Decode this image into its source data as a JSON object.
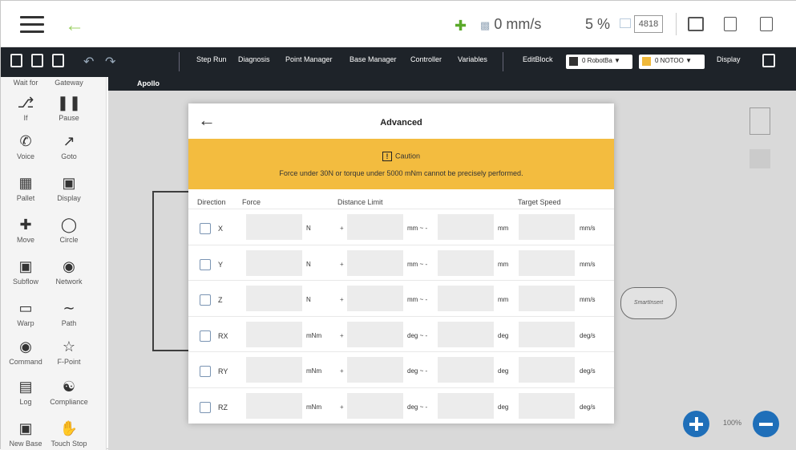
{
  "topbar": {
    "speed": "0 mm/s",
    "percent": "5 %",
    "code": "4818"
  },
  "toolbar": {
    "step_run": "Step Run",
    "diagnosis": "Diagnosis",
    "point_manager": "Point Manager",
    "base_manager": "Base Manager",
    "controller": "Controller",
    "variables": "Variables",
    "editblock": "EditBlock",
    "robot_select": "0 RobotBa",
    "tool_select": "0 NOTOO",
    "display": "Display"
  },
  "palette": [
    {
      "label": "Wait for",
      "icon": "wait-icon"
    },
    {
      "label": "Gateway",
      "icon": "gateway-icon"
    },
    {
      "label": "If",
      "icon": "if-icon"
    },
    {
      "label": "Pause",
      "icon": "pause-icon"
    },
    {
      "label": "Voice",
      "icon": "voice-icon"
    },
    {
      "label": "Goto",
      "icon": "goto-icon"
    },
    {
      "label": "Pallet",
      "icon": "pallet-icon"
    },
    {
      "label": "Display",
      "icon": "display-icon"
    },
    {
      "label": "Move",
      "icon": "move-icon"
    },
    {
      "label": "Circle",
      "icon": "circle-icon"
    },
    {
      "label": "Subflow",
      "icon": "subflow-icon"
    },
    {
      "label": "Network",
      "icon": "network-icon"
    },
    {
      "label": "Warp",
      "icon": "warp-icon"
    },
    {
      "label": "Path",
      "icon": "path-icon"
    },
    {
      "label": "Command",
      "icon": "command-icon"
    },
    {
      "label": "F-Point",
      "icon": "fpoint-icon"
    },
    {
      "label": "Log",
      "icon": "log-icon"
    },
    {
      "label": "Compliance",
      "icon": "compliance-icon"
    },
    {
      "label": "New Base",
      "icon": "new-base-icon"
    },
    {
      "label": "Touch Stop",
      "icon": "touch-stop-icon"
    }
  ],
  "canvas": {
    "flow_name": "Apollo",
    "node_label": "SmartInsert",
    "zoom": "100%"
  },
  "dialog": {
    "title": "Advanced",
    "caution_title": "Caution",
    "caution_message": "Force under 30N or torque under 5000 mNm cannot be precisely performed.",
    "headers": {
      "direction": "Direction",
      "force": "Force",
      "distance_limit": "Distance Limit",
      "target_speed": "Target Speed"
    },
    "plus_sign": "+",
    "rows": [
      {
        "axis": "X",
        "force_unit": "N",
        "dist_unit_from": "mm ~ -",
        "dist_unit_to": "mm",
        "speed_unit": "mm/s"
      },
      {
        "axis": "Y",
        "force_unit": "N",
        "dist_unit_from": "mm ~ -",
        "dist_unit_to": "mm",
        "speed_unit": "mm/s"
      },
      {
        "axis": "Z",
        "force_unit": "N",
        "dist_unit_from": "mm ~ -",
        "dist_unit_to": "mm",
        "speed_unit": "mm/s"
      },
      {
        "axis": "RX",
        "force_unit": "mNm",
        "dist_unit_from": "deg ~ -",
        "dist_unit_to": "deg",
        "speed_unit": "deg/s"
      },
      {
        "axis": "RY",
        "force_unit": "mNm",
        "dist_unit_from": "deg ~ -",
        "dist_unit_to": "deg",
        "speed_unit": "deg/s"
      },
      {
        "axis": "RZ",
        "force_unit": "mNm",
        "dist_unit_from": "deg ~ -",
        "dist_unit_to": "deg",
        "speed_unit": "deg/s"
      }
    ]
  },
  "colors": {
    "caution_bg": "#f3bc3f",
    "toolbar_bg": "#1e2329",
    "zoom_button": "#1f6fb9"
  }
}
